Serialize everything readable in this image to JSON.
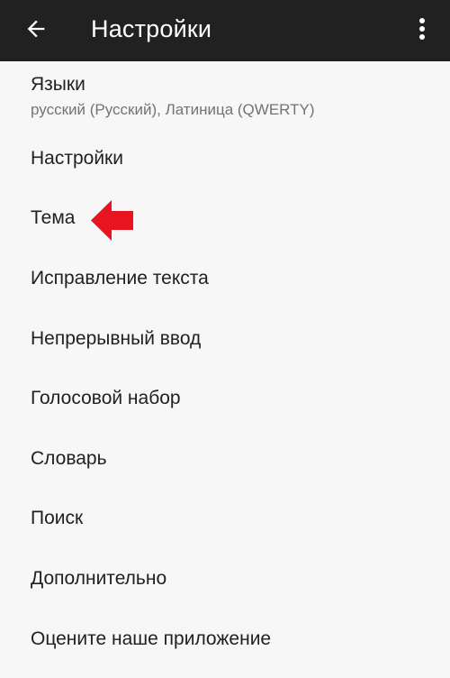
{
  "toolbar": {
    "title": "Настройки",
    "back_icon": "arrow-left-icon",
    "menu_icon": "more-vertical-icon"
  },
  "items": [
    {
      "title": "Языки",
      "summary": "русский (Русский), Латиница (QWERTY)"
    },
    {
      "title": "Настройки"
    },
    {
      "title": "Тема"
    },
    {
      "title": "Исправление текста"
    },
    {
      "title": "Непрерывный ввод"
    },
    {
      "title": "Голосовой набор"
    },
    {
      "title": "Словарь"
    },
    {
      "title": "Поиск"
    },
    {
      "title": "Дополнительно"
    },
    {
      "title": "Оцените наше приложение"
    }
  ],
  "colors": {
    "toolbar_bg": "#212121",
    "background": "#f7f7f7",
    "text_primary": "#212121",
    "text_secondary": "#737373",
    "annotation_arrow": "#e8141f"
  }
}
